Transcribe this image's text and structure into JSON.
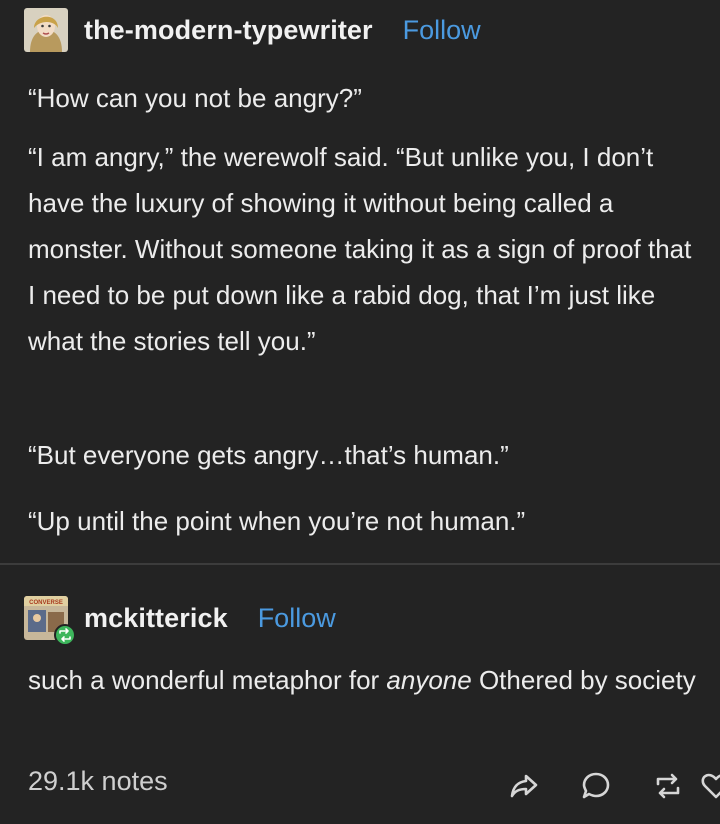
{
  "post": {
    "username": "the-modern-typewriter",
    "follow_label": "Follow",
    "paragraphs": [
      "“How can you not be angry?”",
      "“I am angry,” the werewolf said. “But unlike you, I don’t have the luxury of showing it without being called a monster. Without someone taking it as a sign of proof that I need to be put down like a rabid dog, that I’m just like what the stories tell you.”",
      "“But everyone gets angry…that’s human.”",
      "“Up until the point when you’re not human.”"
    ]
  },
  "reblog": {
    "username": "mckitterick",
    "follow_label": "Follow",
    "avatar_text": "CONVERSE",
    "comment_before": "such a wonderful metaphor for ",
    "comment_emphasis": "anyone",
    "comment_after": " Othered by society"
  },
  "footer": {
    "notes_label": "29.1k notes",
    "icons": [
      "share-icon",
      "reply-icon",
      "reblog-icon",
      "like-icon"
    ]
  },
  "colors": {
    "background": "#232323",
    "text": "#ececec",
    "follow": "#4b9ae0",
    "reblog_badge": "#3db65c",
    "divider": "#3c3c3c"
  }
}
